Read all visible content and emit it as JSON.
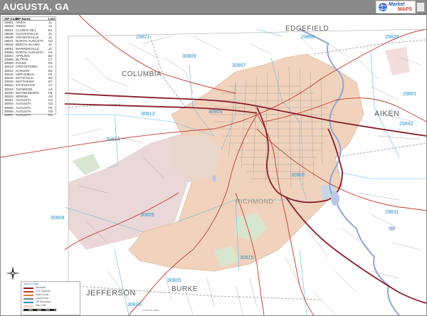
{
  "title": "AUGUSTA, GA",
  "brand": {
    "line1": "Market",
    "line2": "MAPS",
    "logo_icon": "globe-icon"
  },
  "colors": {
    "city_fill": "#f1d3bd",
    "county_fill": "#e9d3d3",
    "water_fill": "#b9c6e6",
    "green_fill": "#cfe3c4",
    "interstate": "#8a1c2b",
    "highway": "#c0392b",
    "local_road": "#7a7a7a",
    "zip_label": "#1f8fc4"
  },
  "index": {
    "headers": [
      "ZIP Code",
      "ZIP Name",
      "LOC"
    ],
    "rows": [
      [
        "29801",
        "AIKEN",
        "J1"
      ],
      [
        "29803",
        "AIKEN",
        "J4"
      ],
      [
        "29821",
        "CLARKS HILL",
        "E1"
      ],
      [
        "29828",
        "GLOVERVILLE",
        "J2"
      ],
      [
        "29829",
        "GRANITEVILLE",
        "J1"
      ],
      [
        "29841",
        "NORTH AUGUSTA",
        "H2"
      ],
      [
        "29842",
        "BEECH ISLAND",
        "J4"
      ],
      [
        "29851",
        "WARRENVILLE",
        "J2"
      ],
      [
        "29860",
        "NORTH AUGUSTA",
        "H1"
      ],
      [
        "30802",
        "APPLING",
        "B2"
      ],
      [
        "30805",
        "BLYTHE",
        "C7"
      ],
      [
        "30809",
        "EVANS",
        "D1"
      ],
      [
        "30813",
        "GROVETOWN",
        "C4"
      ],
      [
        "30814",
        "HARLEM",
        "B4"
      ],
      [
        "30815",
        "HEPHZIBAH",
        "F5"
      ],
      [
        "30816",
        "KEYSVILLE",
        "E8"
      ],
      [
        "30818",
        "MATTHEWS",
        "B7"
      ],
      [
        "30823",
        "STAPLETON",
        "A7"
      ],
      [
        "30824",
        "THOMSON",
        "A4"
      ],
      [
        "30830",
        "WAYNESBORO",
        "F8"
      ],
      [
        "30833",
        "WRENS",
        "A8"
      ],
      [
        "30901",
        "AUGUSTA",
        "H4"
      ],
      [
        "30904",
        "AUGUSTA",
        "G3"
      ],
      [
        "30905",
        "AUGUSTA",
        "F5"
      ],
      [
        "30906",
        "AUGUSTA",
        "G5"
      ],
      [
        "30907",
        "AUGUSTA",
        "E3"
      ],
      [
        "30909",
        "AUGUSTA",
        "F3"
      ],
      [
        "30912",
        "AUGUSTA",
        "G3"
      ]
    ]
  },
  "zip_labels": [
    "29821",
    "29860",
    "29829",
    "30809",
    "30907",
    "29801",
    "30813",
    "30909",
    "29842",
    "30814",
    "30906",
    "29831",
    "30808",
    "30805",
    "30815",
    "30805",
    "30816"
  ],
  "place_labels": [
    "COLUMBIA",
    "EDGEFIELD",
    "AIKEN",
    "JEFFERSON",
    "BURKE",
    "RICHMOND"
  ],
  "legend": {
    "title": "Market Maps",
    "items": [
      {
        "label": "Interstate",
        "color": "#8a1c2b"
      },
      {
        "label": "U.S. Highway",
        "color": "#c0392b"
      },
      {
        "label": "State Route",
        "color": "#e07b39"
      },
      {
        "label": "Local Road",
        "color": "#7a7a7a"
      },
      {
        "label": "ZIP Boundary",
        "color": "#1f8fc4"
      },
      {
        "label": "City Limit",
        "color": "#f1d3bd"
      }
    ]
  },
  "compass_icon": "compass-rose-icon",
  "copyright": "© Market Maps"
}
